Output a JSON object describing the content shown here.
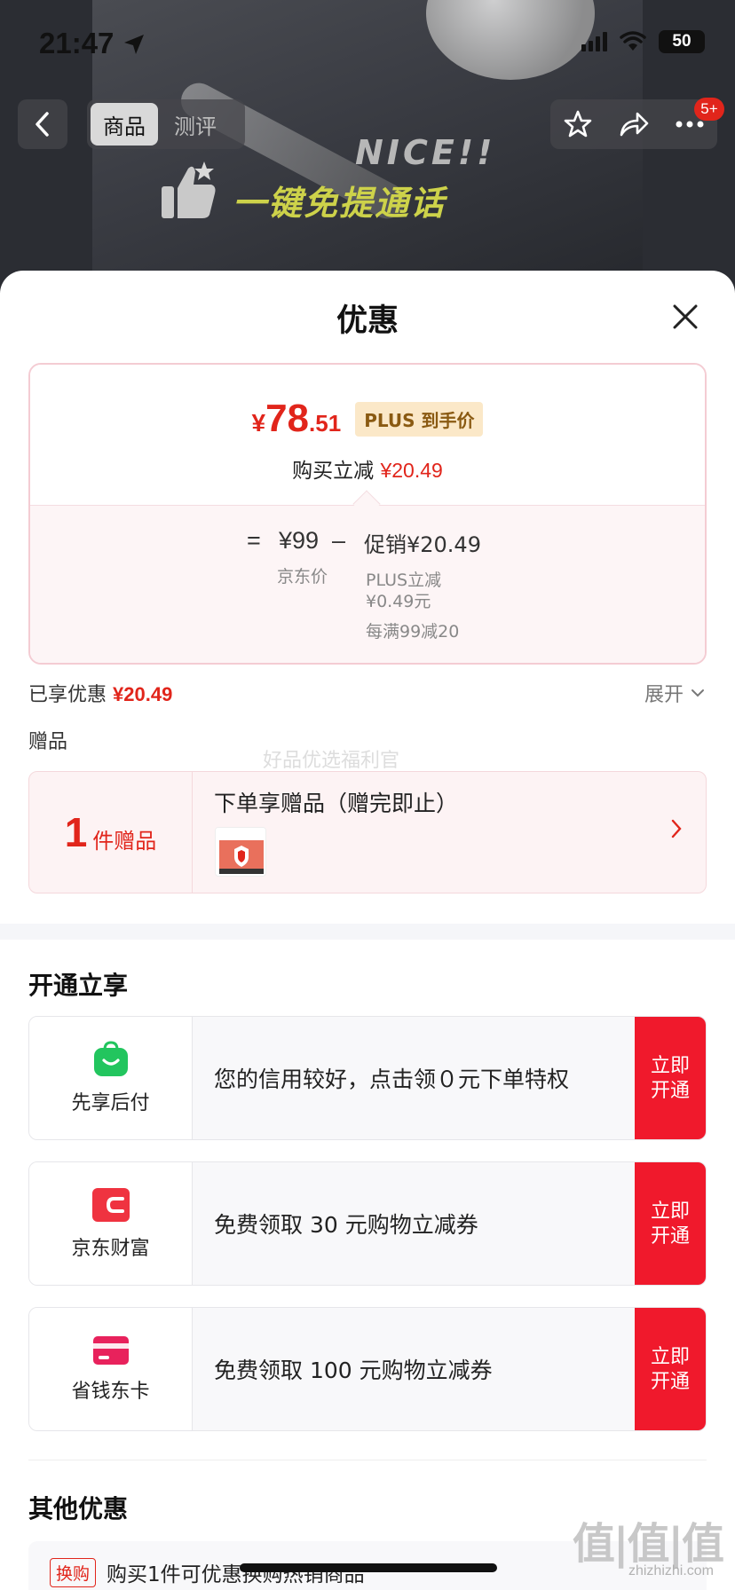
{
  "status_bar": {
    "time": "21:47",
    "battery": "50"
  },
  "hero": {
    "nice_text": "NICE!!",
    "slogan": "一键免提通话"
  },
  "nav": {
    "tab_product": "商品",
    "tab_review": "测评",
    "cart_badge": "5+"
  },
  "sheet": {
    "title": "优惠",
    "price": {
      "yen": "¥",
      "int": "78",
      "dec": ".51",
      "plus_tag": "PLUS 到手价"
    },
    "reduce": {
      "label": "购买立减",
      "amount": "¥20.49"
    },
    "formula": {
      "equals": "=",
      "jd_price": "¥99",
      "jd_price_label": "京东价",
      "minus": "–",
      "promo": "促销¥20.49",
      "plus_reduce": "PLUS立减",
      "plus_reduce_amount": "¥0.49元",
      "full_reduce": "每满99减20"
    },
    "enjoyed": {
      "label": "已享优惠",
      "amount": "¥20.49",
      "expand": "展开"
    },
    "gift_label": "赠品",
    "watermark": "好品优选福利官",
    "gift": {
      "count": "1",
      "count_label": "件赠品",
      "title": "下单享赠品（赠完即止）"
    },
    "open_title": "开通立享",
    "services": [
      {
        "name": "先享后付",
        "desc": "您的信用较好，点击领０元下单特权",
        "btn": "立即开通"
      },
      {
        "name": "京东财富",
        "desc": "免费领取 30 元购物立减券",
        "btn": "立即开通"
      },
      {
        "name": "省钱东卡",
        "desc": "免费领取 100 元购物立减券",
        "btn": "立即开通"
      }
    ],
    "other_title": "其他优惠",
    "other": {
      "tag": "换购",
      "text": "购买1件可优惠换购热销商品"
    }
  },
  "brand": {
    "logo": "值|值|值",
    "url": "zhizhizhi.com"
  },
  "colors": {
    "accent_red": "#e1251b",
    "button_red": "#f0192c",
    "plus_gold": "#8a5a12"
  }
}
